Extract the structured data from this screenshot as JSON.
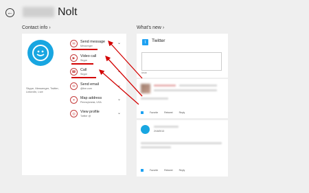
{
  "header": {
    "back_symbol": "←",
    "name": "Nolt"
  },
  "contact_info": {
    "heading": "Contact info",
    "chevron": "›",
    "sources": "Skype, Messenger, Twitter, LinkedIn, Live",
    "actions": [
      {
        "id": "send-message",
        "icon": "chat-icon",
        "glyph": "✉",
        "label": "Send message",
        "sub": "Messenger",
        "chevron": "⌄"
      },
      {
        "id": "video-call",
        "icon": "video-icon",
        "glyph": "▶",
        "label": "Video call",
        "sub": "Skype",
        "chevron": ""
      },
      {
        "id": "call",
        "icon": "phone-icon",
        "glyph": "☎",
        "label": "Call",
        "sub": "Skype",
        "chevron": "⌄"
      },
      {
        "id": "send-email",
        "icon": "mail-icon",
        "glyph": "✉",
        "label": "Send email",
        "sub": "@live.com",
        "chevron": "⌄"
      },
      {
        "id": "map-address",
        "icon": "map-pin-icon",
        "glyph": "⌖",
        "label": "Map address",
        "sub": "Pennsylvania, USA",
        "chevron": "⌄"
      },
      {
        "id": "view-profile",
        "icon": "profile-icon",
        "glyph": "◎",
        "label": "View profile",
        "sub": "Twitter @",
        "chevron": "⌄"
      }
    ]
  },
  "whats_new": {
    "heading": "What's new",
    "chevron": "›",
    "twitter": {
      "title": "Twitter",
      "logo_glyph": "t",
      "counter": "0/140"
    },
    "posts": [
      {
        "actions": [
          "Favorite",
          "Retweet",
          "Reply"
        ]
      },
      {
        "date": "2/18/2013",
        "actions": [
          "Favorite",
          "Retweet",
          "Reply"
        ]
      }
    ]
  },
  "colors": {
    "accent_red": "#d30000",
    "skype_blue": "#18a6e1",
    "twitter_blue": "#1da1f2"
  }
}
